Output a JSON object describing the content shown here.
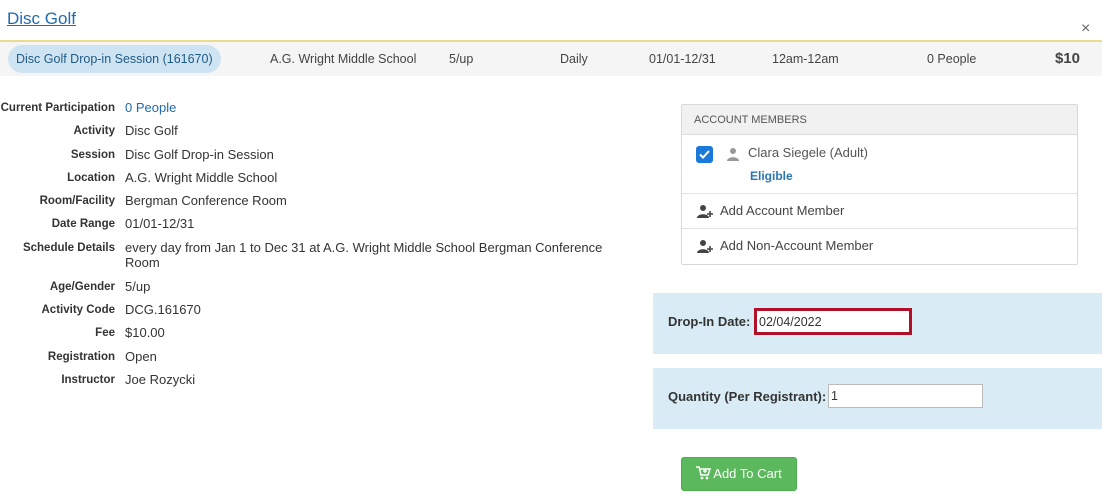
{
  "header": {
    "title": "Disc Golf",
    "close_glyph": "×"
  },
  "summary": {
    "session_pill": "Disc Golf Drop-in Session (161670)",
    "location": "A.G. Wright Middle School",
    "age": "5/up",
    "frequency": "Daily",
    "date_range": "01/01-12/31",
    "time": "12am-12am",
    "people": "0 People",
    "fee": "$10"
  },
  "details": {
    "current_participation": {
      "label": "Current Participation",
      "value": "0 People"
    },
    "activity": {
      "label": "Activity",
      "value": "Disc Golf"
    },
    "session": {
      "label": "Session",
      "value": "Disc Golf Drop-in Session"
    },
    "location": {
      "label": "Location",
      "value": "A.G. Wright Middle School"
    },
    "room": {
      "label": "Room/Facility",
      "value": "Bergman Conference Room"
    },
    "date_range": {
      "label": "Date Range",
      "value": "01/01-12/31"
    },
    "schedule": {
      "label": "Schedule Details",
      "value": "every day from Jan 1 to Dec 31 at A.G. Wright Middle School Bergman Conference Room"
    },
    "age_gender": {
      "label": "Age/Gender",
      "value": "5/up"
    },
    "activity_code": {
      "label": "Activity Code",
      "value": "DCG.161670"
    },
    "fee": {
      "label": "Fee",
      "value": "$10.00"
    },
    "registration": {
      "label": "Registration",
      "value": "Open"
    },
    "instructor": {
      "label": "Instructor",
      "value": "Joe Rozycki"
    }
  },
  "members": {
    "header": "ACCOUNT MEMBERS",
    "member_name": "Clara Siegele (Adult)",
    "member_status": "Eligible",
    "member_checked": true,
    "add_account_member": "Add Account Member",
    "add_non_account_member": "Add Non-Account Member"
  },
  "dropin": {
    "label": "Drop-In Date:",
    "value": "02/04/2022"
  },
  "quantity": {
    "label": "Quantity (Per Registrant):",
    "value": "1"
  },
  "cart": {
    "label": "Add To Cart"
  },
  "colors": {
    "accent_blue": "#1f6bb0",
    "highlight_red": "#b0102a",
    "cart_green": "#5cb85c",
    "panel_blue": "#d9ecf6"
  }
}
